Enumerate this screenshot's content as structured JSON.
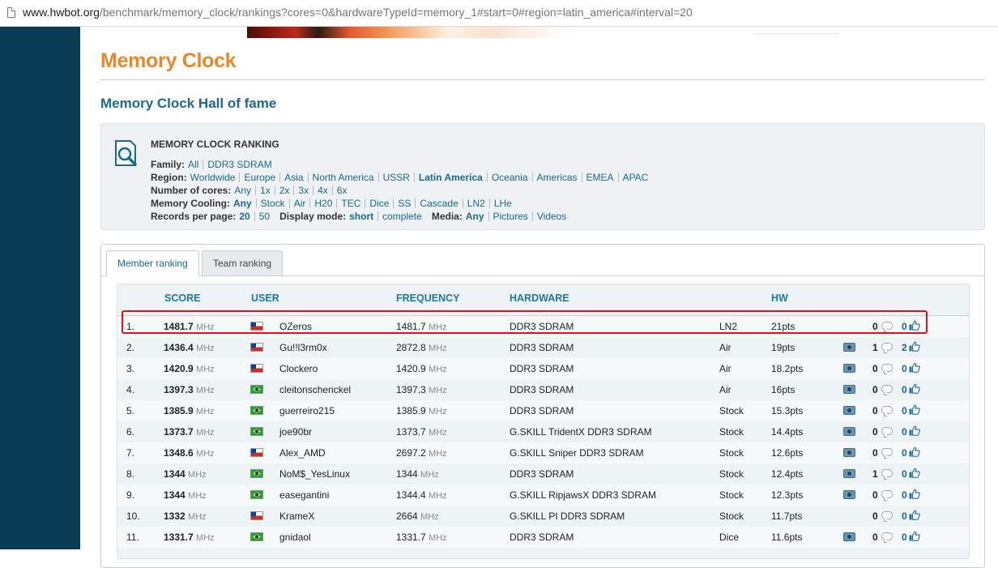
{
  "browser": {
    "url_host": "www.hwbot.org",
    "url_path": "/benchmark/memory_clock/rankings?cores=0&hardwareTypeId=memory_1#start=0#region=latin_america#interval=20"
  },
  "page": {
    "title": "Memory Clock",
    "subtitle": "Memory Clock Hall of fame"
  },
  "filters": {
    "heading": "MEMORY CLOCK RANKING",
    "family": {
      "label": "Family:",
      "options": [
        "All",
        "DDR3 SDRAM"
      ]
    },
    "region": {
      "label": "Region:",
      "options": [
        "Worldwide",
        "Europe",
        "Asia",
        "North America",
        "USSR",
        "Latin America",
        "Oceania",
        "Americas",
        "EMEA",
        "APAC"
      ],
      "selected": "Latin America"
    },
    "cores": {
      "label": "Number of cores:",
      "options": [
        "Any",
        "1x",
        "2x",
        "3x",
        "4x",
        "6x"
      ]
    },
    "cooling": {
      "label": "Memory Cooling:",
      "options": [
        "Any",
        "Stock",
        "Air",
        "H20",
        "TEC",
        "Dice",
        "SS",
        "Cascade",
        "LN2",
        "LHe"
      ],
      "selected": "Any"
    },
    "records": {
      "label": "Records per page:",
      "options": [
        "20",
        "50"
      ],
      "selected": "20"
    },
    "display": {
      "label": "Display mode:",
      "options": [
        "short",
        "complete"
      ],
      "selected": "short"
    },
    "media": {
      "label": "Media:",
      "options": [
        "Any",
        "Pictures",
        "Videos"
      ],
      "selected": "Any"
    }
  },
  "tabs": {
    "member": "Member ranking",
    "team": "Team ranking"
  },
  "columns": {
    "score": "SCORE",
    "user": "USER",
    "frequency": "FREQUENCY",
    "hardware": "HARDWARE",
    "hw": "HW"
  },
  "unit": "MHz",
  "rows": [
    {
      "rank": "1.",
      "score": "1481.7",
      "flag": "cl",
      "user": "OZeros",
      "freq": "1481.7",
      "hardware": "DDR3 SDRAM",
      "cooling": "LN2",
      "pts": "21pts",
      "camera": false,
      "comments": "0",
      "likes": "0"
    },
    {
      "rank": "2.",
      "score": "1436.4",
      "flag": "cl",
      "user": "Gu!!l3rm0x",
      "freq": "2872.8",
      "hardware": "DDR3 SDRAM",
      "cooling": "Air",
      "pts": "19pts",
      "camera": true,
      "comments": "1",
      "likes": "2"
    },
    {
      "rank": "3.",
      "score": "1420.9",
      "flag": "cl",
      "user": "Clockero",
      "freq": "1420.9",
      "hardware": "DDR3 SDRAM",
      "cooling": "Air",
      "pts": "18.2pts",
      "camera": true,
      "comments": "0",
      "likes": "0"
    },
    {
      "rank": "4.",
      "score": "1397.3",
      "flag": "br",
      "user": "cleitonschenckel",
      "freq": "1397.3",
      "hardware": "DDR3 SDRAM",
      "cooling": "Air",
      "pts": "16pts",
      "camera": true,
      "comments": "0",
      "likes": "0"
    },
    {
      "rank": "5.",
      "score": "1385.9",
      "flag": "br",
      "user": "guerreiro215",
      "freq": "1385.9",
      "hardware": "DDR3 SDRAM",
      "cooling": "Stock",
      "pts": "15.3pts",
      "camera": true,
      "comments": "0",
      "likes": "0"
    },
    {
      "rank": "6.",
      "score": "1373.7",
      "flag": "br",
      "user": "joe90br",
      "freq": "1373.7",
      "hardware": "G.SKILL TridentX DDR3 SDRAM",
      "cooling": "Stock",
      "pts": "14.4pts",
      "camera": true,
      "comments": "0",
      "likes": "0"
    },
    {
      "rank": "7.",
      "score": "1348.6",
      "flag": "cl",
      "user": "Alex_AMD",
      "freq": "2697.2",
      "hardware": "G.SKILL Sniper DDR3 SDRAM",
      "cooling": "Stock",
      "pts": "12.6pts",
      "camera": true,
      "comments": "0",
      "likes": "0"
    },
    {
      "rank": "8.",
      "score": "1344",
      "flag": "br",
      "user": "NoM$_YesLinux",
      "freq": "1344",
      "hardware": "DDR3 SDRAM",
      "cooling": "Stock",
      "pts": "12.4pts",
      "camera": true,
      "comments": "1",
      "likes": "0"
    },
    {
      "rank": "9.",
      "score": "1344",
      "flag": "br",
      "user": "easegantini",
      "freq": "1344.4",
      "hardware": "G.SKILL RipjawsX DDR3 SDRAM",
      "cooling": "Stock",
      "pts": "12.3pts",
      "camera": true,
      "comments": "0",
      "likes": "0"
    },
    {
      "rank": "10.",
      "score": "1332",
      "flag": "cl",
      "user": "KrameX",
      "freq": "2664",
      "hardware": "G.SKILL PI DDR3 SDRAM",
      "cooling": "Stock",
      "pts": "11.7pts",
      "camera": false,
      "comments": "0",
      "likes": "0"
    },
    {
      "rank": "11.",
      "score": "1331.7",
      "flag": "br",
      "user": "gnidaol",
      "freq": "1331.7",
      "hardware": "DDR3 SDRAM",
      "cooling": "Dice",
      "pts": "11.6pts",
      "camera": true,
      "comments": "0",
      "likes": "0"
    }
  ],
  "colors": {
    "accent_orange": "#e8872d",
    "link_blue": "#1a6a8e",
    "sidebar": "#0b3c55",
    "highlight_red": "#e3101b"
  }
}
